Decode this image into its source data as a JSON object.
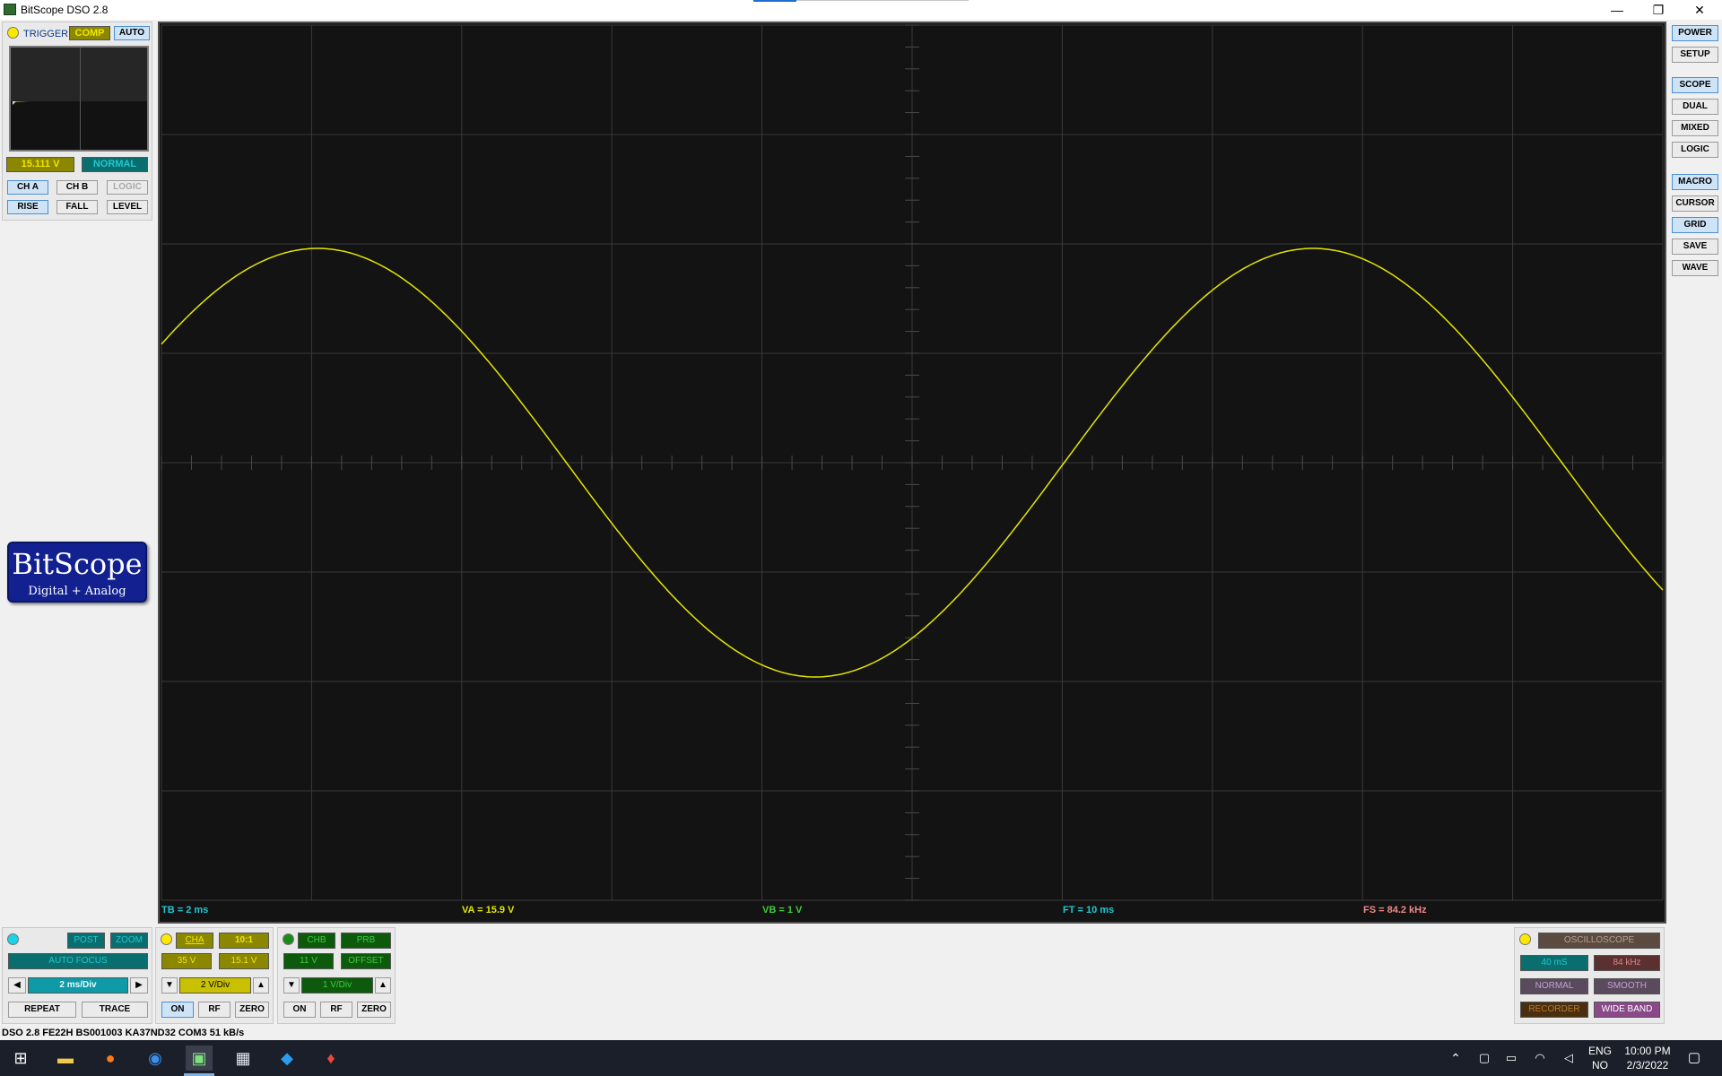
{
  "window": {
    "title": "BitScope DSO 2.8",
    "minimize_glyph": "—",
    "restore_glyph": "❐",
    "close_glyph": "✕"
  },
  "trigger": {
    "label": "TRIGGER",
    "comp": "COMP",
    "auto": "AUTO",
    "level_value": "15.111 V",
    "mode": "NORMAL",
    "sources": [
      "CH A",
      "CH B",
      "LOGIC"
    ],
    "edges": [
      "RISE",
      "FALL",
      "LEVEL"
    ]
  },
  "logo": {
    "name": "BitScope",
    "sub": "Digital + Analog"
  },
  "readouts": {
    "tb": "TB = 2 ms",
    "va": "VA = 15.9 V",
    "vb": "VB = 1 V",
    "ft": "FT = 10 ms",
    "fs": "FS = 84.2 kHz"
  },
  "right_buttons": [
    "POWER",
    "SETUP",
    "SCOPE",
    "DUAL",
    "MIXED",
    "LOGIC",
    "MACRO",
    "CURSOR",
    "GRID",
    "SAVE",
    "WAVE"
  ],
  "timebase": {
    "post": "POST",
    "zoom": "ZOOM",
    "autofocus": "AUTO FOCUS",
    "value": "2 ms/Div",
    "repeat": "REPEAT",
    "trace": "TRACE",
    "left_arrow": "◀",
    "right_arrow": "▶"
  },
  "channel_a": {
    "name": "CHA",
    "probe": "10:1",
    "range": "35 V",
    "offset": "15.1 V",
    "vdiv": "2 V/Div",
    "on": "ON",
    "rf": "RF",
    "zero": "ZERO"
  },
  "channel_b": {
    "name": "CHB",
    "probe": "PRB",
    "range": "11 V",
    "offset": "OFFSET",
    "vdiv": "1 V/Div",
    "on": "ON",
    "rf": "RF",
    "zero": "ZERO"
  },
  "capture": {
    "mode": "OSCILLOSCOPE",
    "duration": "40 mS",
    "rate": "84 kHz",
    "normal": "NORMAL",
    "smooth": "SMOOTH",
    "recorder": "RECORDER",
    "wideband": "WIDE BAND"
  },
  "status": {
    "text": "DSO 2.8 FE22H BS001003 KA37ND32 COM3 51 kB/s"
  },
  "tray": {
    "lang": "ENG",
    "region": "NO",
    "time": "10:00 PM",
    "date": "2/3/2022"
  },
  "colors": {
    "trace": "#e6e600",
    "grid": "#3a3a3a",
    "cyan": "#1ec8d2",
    "yellow_box": "#8c8700",
    "teal_box": "#0a6e6e"
  }
}
